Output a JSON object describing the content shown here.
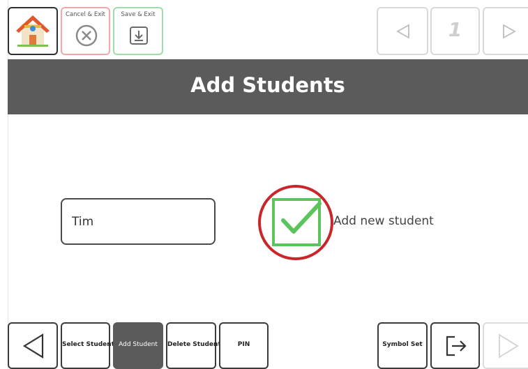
{
  "toolbar": {
    "home_icon": "house-icon",
    "cancel_label": "Cancel & Exit",
    "cancel_icon": "circle-x-icon",
    "save_label": "Save & Exit",
    "save_icon": "save-download-icon",
    "page_number": "1",
    "prev_icon": "triangle-left-icon",
    "next_icon": "triangle-right-icon"
  },
  "header": {
    "title": "Add Students"
  },
  "form": {
    "name_value": "Tim",
    "add_label": "Add new student",
    "add_icon": "checkbox-check-icon"
  },
  "bottom_bar": {
    "back_icon": "triangle-left-icon",
    "select_student": "Select Student",
    "add_student": "Add Student",
    "delete_student": "Delete Student",
    "pin": "PIN",
    "symbol_set": "Symbol Set",
    "exit_icon": "exit-arrow-icon",
    "forward_icon": "triangle-right-icon"
  },
  "colors": {
    "header_bg": "#5b5b5b",
    "cancel_border": "#f0a8a8",
    "save_border": "#9fdca7",
    "check_green": "#5cc45c",
    "highlight_circle": "#c8262b",
    "disabled_gray": "#d9d9d9"
  }
}
